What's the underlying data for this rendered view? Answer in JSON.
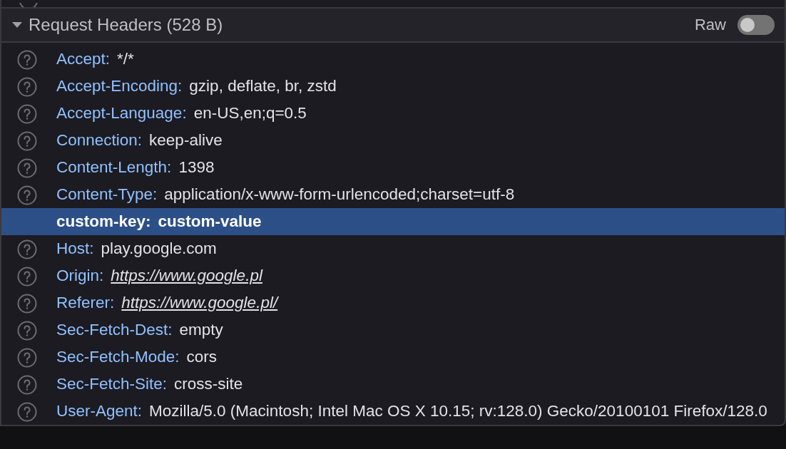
{
  "section": {
    "title": "Request Headers (528 B)",
    "expanded": true,
    "raw_toggle": {
      "label": "Raw",
      "on": false
    }
  },
  "headers": [
    {
      "name": "Accept:",
      "value": "*/*",
      "kind": "text",
      "help": true,
      "selected": false
    },
    {
      "name": "Accept-Encoding:",
      "value": "gzip, deflate, br, zstd",
      "kind": "text",
      "help": true,
      "selected": false
    },
    {
      "name": "Accept-Language:",
      "value": "en-US,en;q=0.5",
      "kind": "text",
      "help": true,
      "selected": false
    },
    {
      "name": "Connection:",
      "value": "keep-alive",
      "kind": "text",
      "help": true,
      "selected": false
    },
    {
      "name": "Content-Length:",
      "value": "1398",
      "kind": "text",
      "help": true,
      "selected": false
    },
    {
      "name": "Content-Type:",
      "value": "application/x-www-form-urlencoded;charset=utf-8",
      "kind": "text",
      "help": true,
      "selected": false
    },
    {
      "name": "custom-key:",
      "value": "custom-value",
      "kind": "text",
      "help": false,
      "selected": true
    },
    {
      "name": "Host:",
      "value": "play.google.com",
      "kind": "text",
      "help": true,
      "selected": false
    },
    {
      "name": "Origin:",
      "value": "https://www.google.pl",
      "kind": "link",
      "help": true,
      "selected": false
    },
    {
      "name": "Referer:",
      "value": "https://www.google.pl/",
      "kind": "link",
      "help": true,
      "selected": false
    },
    {
      "name": "Sec-Fetch-Dest:",
      "value": "empty",
      "kind": "text",
      "help": true,
      "selected": false
    },
    {
      "name": "Sec-Fetch-Mode:",
      "value": "cors",
      "kind": "text",
      "help": true,
      "selected": false
    },
    {
      "name": "Sec-Fetch-Site:",
      "value": "cross-site",
      "kind": "text",
      "help": true,
      "selected": false
    },
    {
      "name": "User-Agent:",
      "value": "Mozilla/5.0 (Macintosh; Intel Mac OS X 10.15; rv:128.0) Gecko/20100101 Firefox/128.0",
      "kind": "text",
      "help": true,
      "selected": false
    }
  ]
}
